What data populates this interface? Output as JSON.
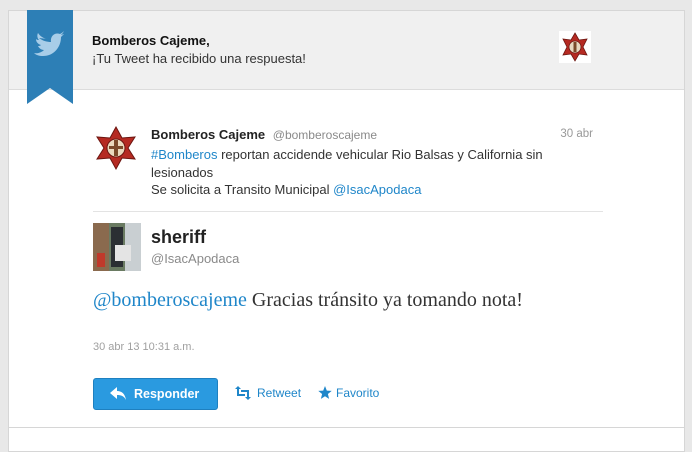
{
  "header": {
    "title": "Bomberos Cajeme,",
    "subtitle": "¡Tu Tweet ha recibido una respuesta!",
    "icon": "twitter-bird-icon",
    "accent": "#2d7fb6"
  },
  "original_tweet": {
    "name": "Bomberos Cajeme",
    "handle": "@bomberoscajeme",
    "time": "30 abr",
    "hashtag": "#Bomberos",
    "text_line1_rest": " reportan accidende vehicular Rio Balsas y California sin lesionados",
    "text_line2": "Se solicita a Transito Municipal ",
    "mention": "@IsacApodaca"
  },
  "reply": {
    "name": "sheriff",
    "handle": "@IsacApodaca",
    "mention": "@bomberoscajeme",
    "text": " Gracias tránsito ya tomando nota!",
    "timestamp": "30 abr 13 10:31 a.m."
  },
  "actions": {
    "reply_label": "Responder",
    "retweet_label": "Retweet",
    "favorite_label": "Favorito"
  }
}
